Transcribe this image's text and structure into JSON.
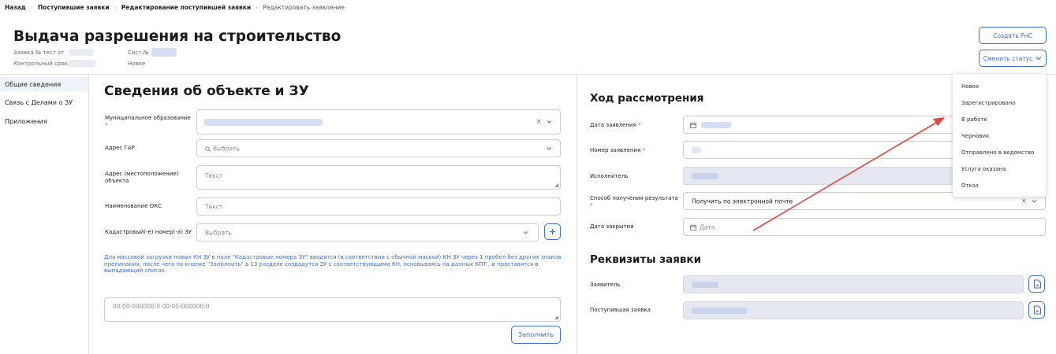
{
  "breadcrumb": {
    "back": "Назад",
    "item1": "Поступившие заявки",
    "item2": "Редактирование поступившей заявки",
    "item3": "Редактировать заявление",
    "sep": "›"
  },
  "header": {
    "title": "Выдача разрешения на строительство",
    "request_label": "Заявка № тест от",
    "sist_label": "Сист.№",
    "deadline_label": "Контрольный срок:",
    "status_value": "Новое",
    "create_button": "Создать РнС",
    "change_status_button": "Сменить статус"
  },
  "sidebar": {
    "items": [
      {
        "label": "Общие сведения"
      },
      {
        "label": "Связь с Делами о ЗУ"
      },
      {
        "label": "Приложения"
      }
    ]
  },
  "object_section": {
    "title": "Сведения об объекте и ЗУ",
    "municipality_label": "Муниципальное образование",
    "gar_label": "Адрес ГАР",
    "gar_placeholder": "Выбрать",
    "address_label": "Адрес (местоположение) объекта",
    "address_placeholder": "Текст",
    "oks_label": "Наименование ОКС",
    "oks_placeholder": "Текст",
    "cadastral_label": "Кадастровый(-е) номер(-а) ЗУ",
    "cadastral_placeholder": "Выбрать",
    "info_text": "Для массовой загрузки новых КН ЗУ в поле \"Кадастровые номера ЗУ\" вводятся (в соответствии с обычной маской) КН ЗУ через 1 пробел без других знаков препинания, после чего по кнопке \"Заполнить\" в 13 разделе создадутся ЗУ с соответствующими КН, основываясь на данных КПТ , и проставятся в выпадающий список.",
    "mass_placeholder": "00:00:000000:0 00:00:000000:0",
    "fill_button": "Заполнить"
  },
  "progress_section": {
    "title": "Ход рассмотрения",
    "date_label": "Дата заявления",
    "number_label": "Номер заявления",
    "executor_label": "Исполнитель",
    "method_label": "Способ получения результата",
    "method_value": "Получить по электронной почте",
    "close_date_label": "Дата закрытия",
    "close_date_placeholder": "Дата"
  },
  "requisites_section": {
    "title": "Реквизиты заявки",
    "applicant_label": "Заявитель",
    "incoming_label": "Поступившая заявка"
  },
  "status_dropdown": {
    "options": [
      "Новое",
      "Зарегистрировано",
      "В работе",
      "Черновик",
      "Отправлено в ведомство",
      "Услуга оказана",
      "Отказ"
    ]
  },
  "icons": {
    "search": "search-icon",
    "calendar": "calendar-icon",
    "chevron": "chevron-down-icon",
    "clear": "clear-icon",
    "plus": "plus-icon",
    "document": "document-icon"
  },
  "colors": {
    "accent": "#3b6fd6",
    "required": "#e0413b",
    "arrow": "#e8453c",
    "blur": "#d5def5",
    "disabled_field": "#e5e8f0"
  }
}
